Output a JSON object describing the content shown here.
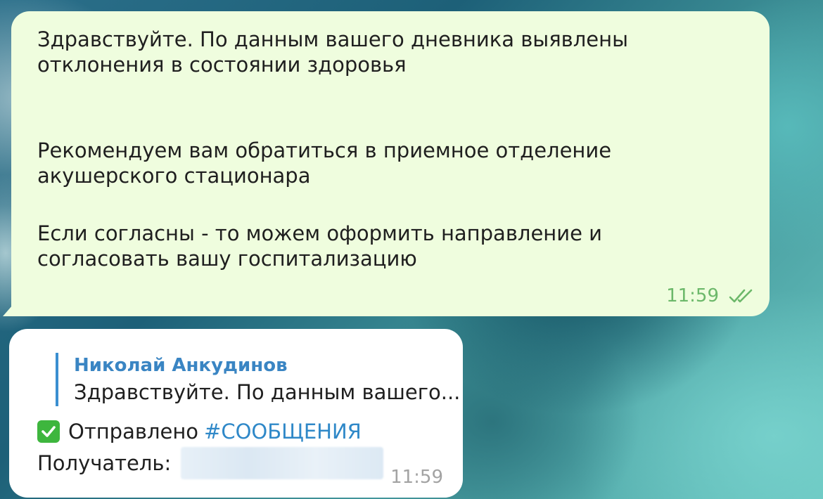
{
  "outgoing_message": {
    "lines": [
      "Здравствуйте. По данным вашего дневника выявлены",
      "отклонения в состоянии здоровья",
      "Рекомендуем вам обратиться в приемное отделение",
      "акушерского стационара",
      "Если согласны - то можем оформить направление и",
      "согласовать вашу госпитализацию"
    ],
    "time": "11:59",
    "status_icon": "double-check-icon",
    "bubble_color": "#effdde"
  },
  "incoming_message": {
    "reply_to": {
      "author": "Николай Анкудинов",
      "preview": "Здравствуйте. По данным вашего..."
    },
    "status_text": "Отправлено",
    "hashtag": "#СООБЩЕНИЯ",
    "status_icon": "check-mark-button-icon",
    "recipient_label": "Получатель:",
    "time": "11:59"
  },
  "colors": {
    "accent_link": "#2f88c8",
    "reply_name": "#3a85c3",
    "read_check": "#6cb86a"
  }
}
